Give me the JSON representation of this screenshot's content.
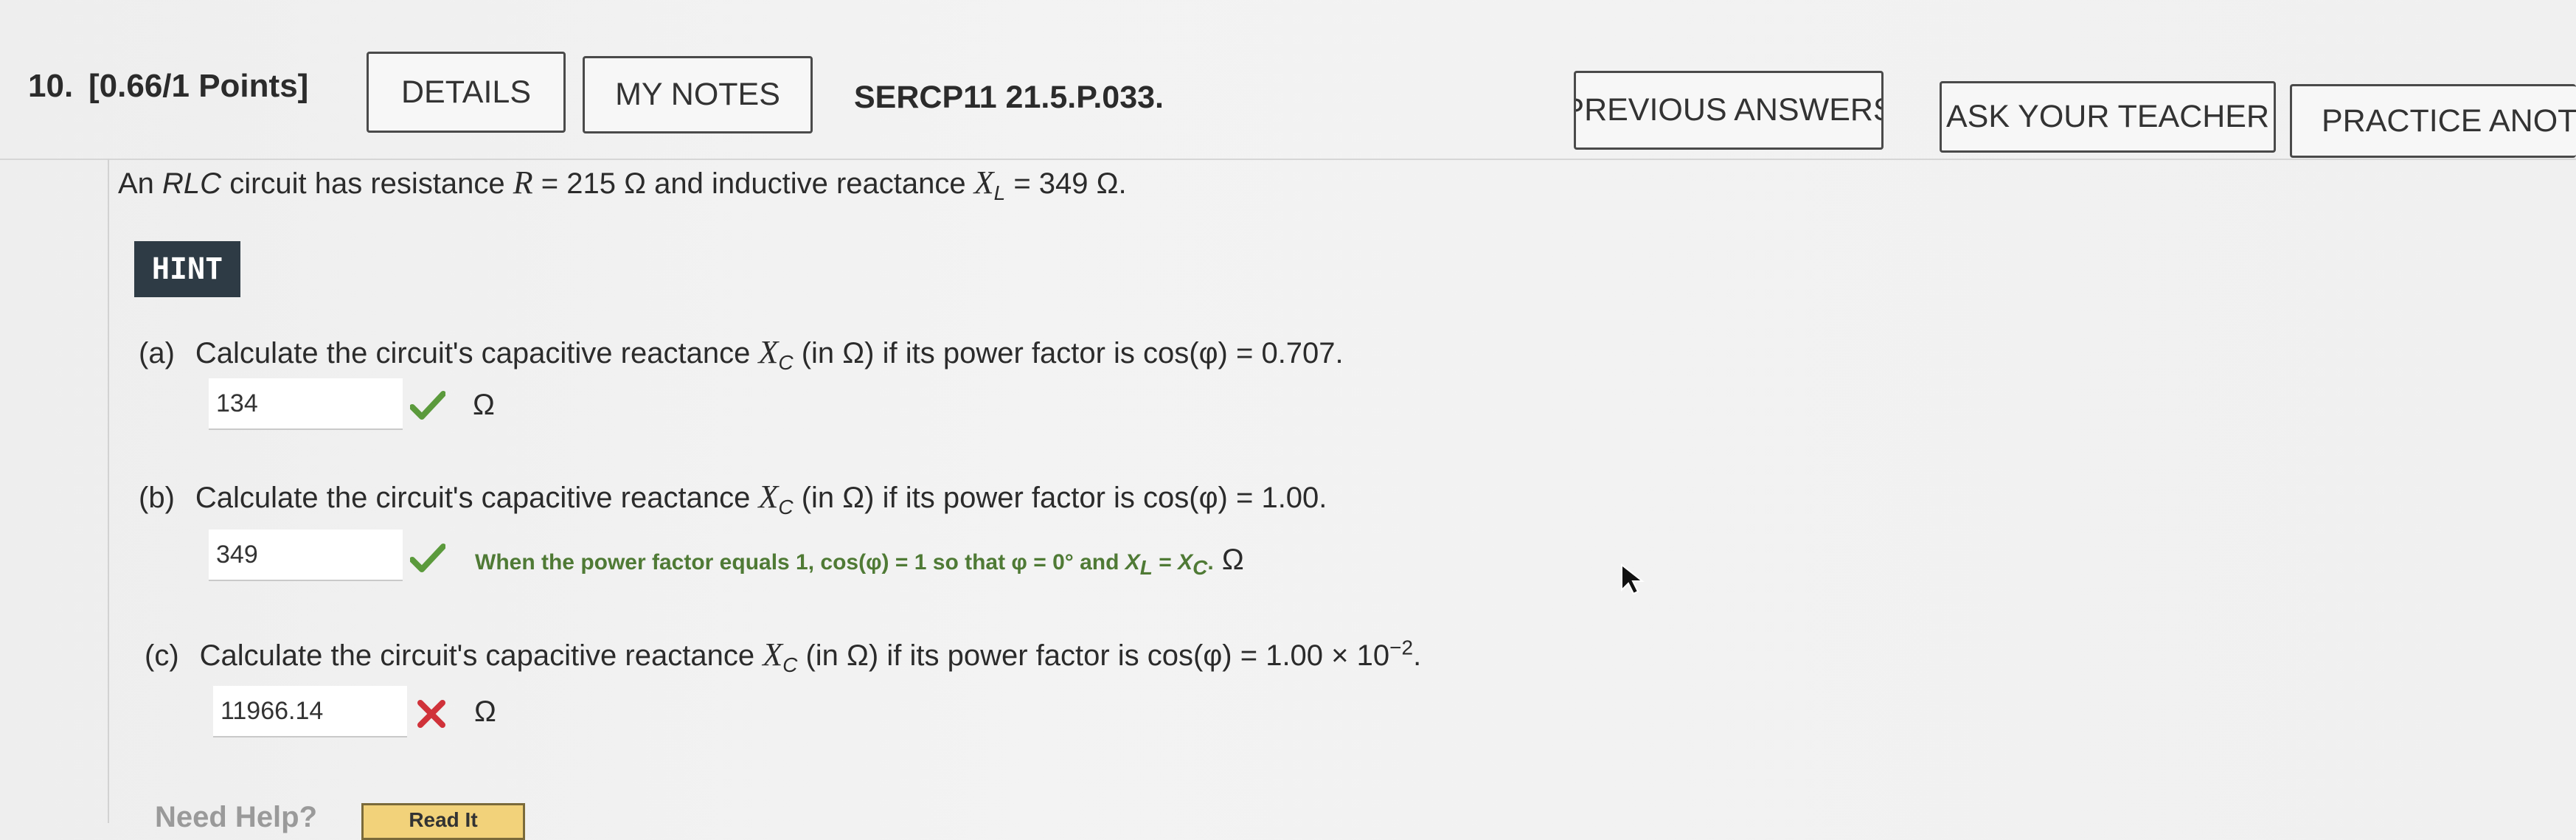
{
  "header": {
    "question_number": "10.",
    "points": "[0.66/1 Points]",
    "details_label": "DETAILS",
    "my_notes_label": "MY NOTES",
    "problem_code": "SERCP11 21.5.P.033.",
    "previous_answers_label": "PREVIOUS ANSWERS",
    "ask_teacher_label": "ASK YOUR TEACHER",
    "practice_label": "PRACTICE ANOTHER"
  },
  "problem": {
    "intro_prefix": "An ",
    "intro_rlc": "RLC",
    "intro_mid": " circuit has resistance ",
    "R_symbol": "R",
    "R_value": " = 215 Ω and inductive reactance ",
    "XL_symbol": "X",
    "XL_sub": "L",
    "XL_value": " = 349 Ω.",
    "hint_label": "HINT"
  },
  "parts": [
    {
      "label": "(a)",
      "text_prefix": "Calculate the circuit's capacitive reactance ",
      "x_symbol": "X",
      "x_sub": "C",
      "text_suffix": " (in Ω) if its power factor is cos(φ) = 0.707.",
      "answer": "134",
      "status": "correct",
      "unit": "Ω"
    },
    {
      "label": "(b)",
      "text_prefix": "Calculate the circuit's capacitive reactance ",
      "x_symbol": "X",
      "x_sub": "C",
      "text_suffix": " (in Ω) if its power factor is cos(φ) = 1.00.",
      "answer": "349",
      "status": "correct",
      "feedback_prefix": "When the power factor equals 1, cos(φ) = 1 so that φ = 0° and ",
      "feedback_xl": "X",
      "feedback_xl_sub": "L",
      "feedback_eq": " = ",
      "feedback_xc": "X",
      "feedback_xc_sub": "C",
      "feedback_suffix": ".",
      "unit": "Ω"
    },
    {
      "label": "(c)",
      "text_prefix": "Calculate the circuit's capacitive reactance ",
      "x_symbol": "X",
      "x_sub": "C",
      "text_suffix": " (in Ω) if its power factor is cos(φ) = 1.00 × 10",
      "text_exp": "−2",
      "text_end": ".",
      "answer": "11966.14",
      "status": "incorrect",
      "unit": "Ω"
    }
  ],
  "help": {
    "need_help_label": "Need Help?",
    "read_it_label": "Read It"
  },
  "colors": {
    "correct_check": "#5b9a3c",
    "incorrect_x": "#d0323a",
    "feedback_text": "#4f7a35",
    "hint_bg": "#2e3b45"
  }
}
